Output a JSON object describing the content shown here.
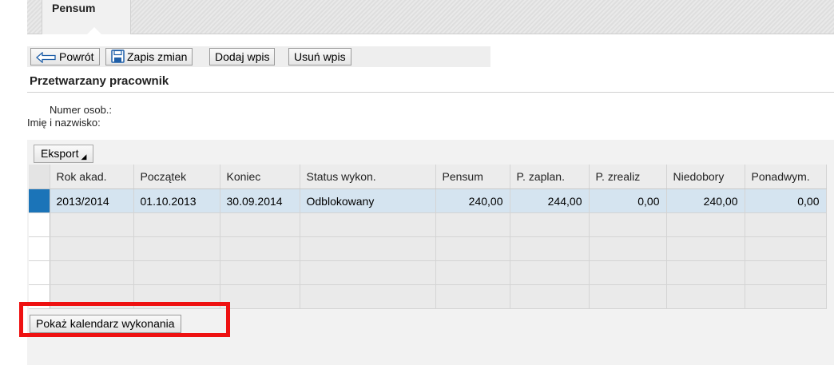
{
  "tabs": [
    {
      "label": "Pensum",
      "active": true
    }
  ],
  "toolbar": {
    "back_label": "Powrót",
    "save_label": "Zapis zmian",
    "add_label": "Dodaj wpis",
    "delete_label": "Usuń wpis"
  },
  "section": {
    "title": "Przetwarzany pracownik",
    "employee_number_label": "Numer osob.:",
    "name_label": "Imię i nazwisko:"
  },
  "grid": {
    "export_label": "Eksport",
    "columns": [
      "Rok akad.",
      "Początek",
      "Koniec",
      "Status wykon.",
      "Pensum",
      "P. zaplan.",
      "P. zrealiz",
      "Niedobory",
      "Ponadwym."
    ],
    "rows": [
      [
        "2013/2014",
        "01.10.2013",
        "30.09.2014",
        "Odblokowany",
        "240,00",
        "244,00",
        "0,00",
        "240,00",
        "0,00"
      ]
    ]
  },
  "footer": {
    "calendar_button_label": "Pokaż kalendarz wykonania"
  },
  "colors": {
    "highlight": "#ee1111",
    "selected_row": "#d5e4f0",
    "row_selector": "#1b74b8"
  },
  "icons": {
    "back": "arrow-left-icon",
    "save": "floppy-disk-icon",
    "export_menu": "dropdown-corner-icon"
  }
}
